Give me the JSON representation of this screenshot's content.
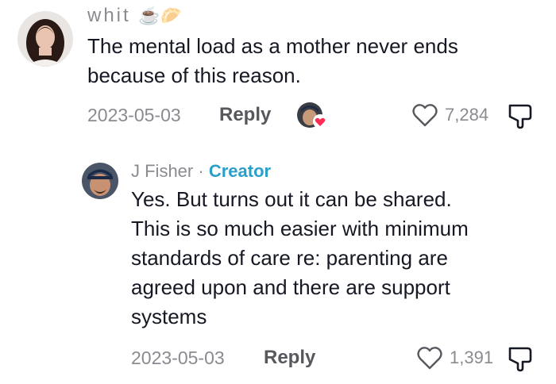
{
  "comments": [
    {
      "username": "whit",
      "username_emoji": "☕🥟",
      "text_line1": "The mental load as a mother never ends",
      "text_line2": "because of this reason.",
      "date": "2023-05-03",
      "reply_label": "Reply",
      "like_count": "7,284",
      "creator_liked": true
    },
    {
      "username": "J Fisher",
      "separator": "·",
      "badge": "Creator",
      "text_lines": [
        "Yes. But turns out it can be shared.",
        "This is so much easier with minimum",
        "standards of care re: parenting are",
        "agreed upon and there are support",
        "systems"
      ],
      "date": "2023-05-03",
      "reply_label": "Reply",
      "like_count": "1,391"
    }
  ],
  "colors": {
    "text": "#161823",
    "muted": "#8a8b91",
    "creator_badge": "#2a9fc9",
    "heart_badge": "#fe2c55"
  }
}
